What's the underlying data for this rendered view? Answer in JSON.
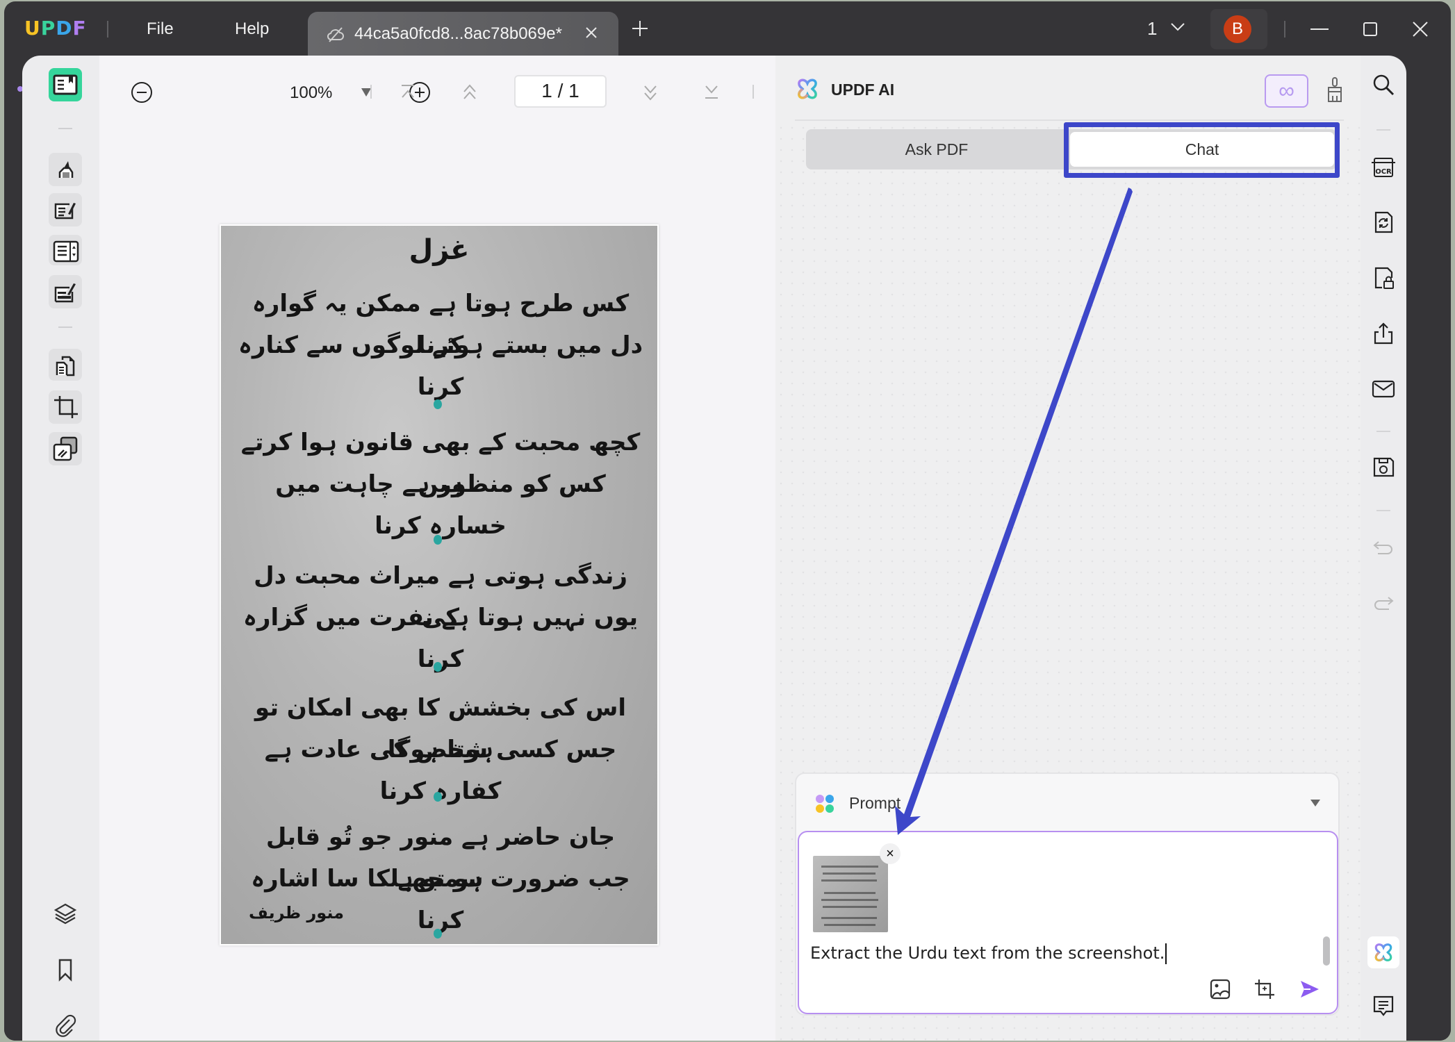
{
  "app": {
    "logo_letters": [
      "U",
      "P",
      "D",
      "F"
    ],
    "menu": [
      "File",
      "Help"
    ],
    "tab_title": "44ca5a0fcd8...8ac78b069e*",
    "page_selector": "1",
    "avatar_initial": "B"
  },
  "toolbar": {
    "zoom_level": "100%",
    "page_indicator": "1 / 1"
  },
  "document": {
    "title": "غزل",
    "lines": [
      "کس طرح ہوتا ہے ممکن یہ گوارہ کرنا",
      "دل میں بستے ہوئے لوگوں سے کنارہ کرنا",
      "کچھ محبت کے بھی قانون ہوا کرتے ہیں",
      "کس کو منظور ہے چاہت میں خسارہ کرنا",
      "زندگی ہوتی ہے میراث محبت دل کی",
      "یوں نہیں ہوتا ہے نفرت میں گزارہ کرنا",
      "اس کی بخشش کا بھی امکان تو ہوتا ہوگا",
      "جس کسی شخص کی عادت ہے کفارہ کرنا",
      "جان حاضر ہے منور جو تُو قابل سمجھے",
      "جب ضرورت ہو تو ہلکا سا اشارہ کرنا"
    ],
    "poet": "منور ظریف"
  },
  "ai_panel": {
    "title": "UPDF AI",
    "tabs": [
      {
        "label": "Ask PDF",
        "active": false
      },
      {
        "label": "Chat",
        "active": true
      }
    ],
    "prompt_label": "Prompt",
    "input_value": "Extract the Urdu text from the screenshot.",
    "attachment_close": "×"
  },
  "colors": {
    "accent_green": "#35d59b",
    "accent_purple": "#b78ff0",
    "annotation_blue": "#3d47c9",
    "avatar_red": "#c93d15",
    "send_purple": "#8c5cf0"
  },
  "annotation": {
    "type": "arrow",
    "from": "Chat tab",
    "to": "prompt input"
  }
}
